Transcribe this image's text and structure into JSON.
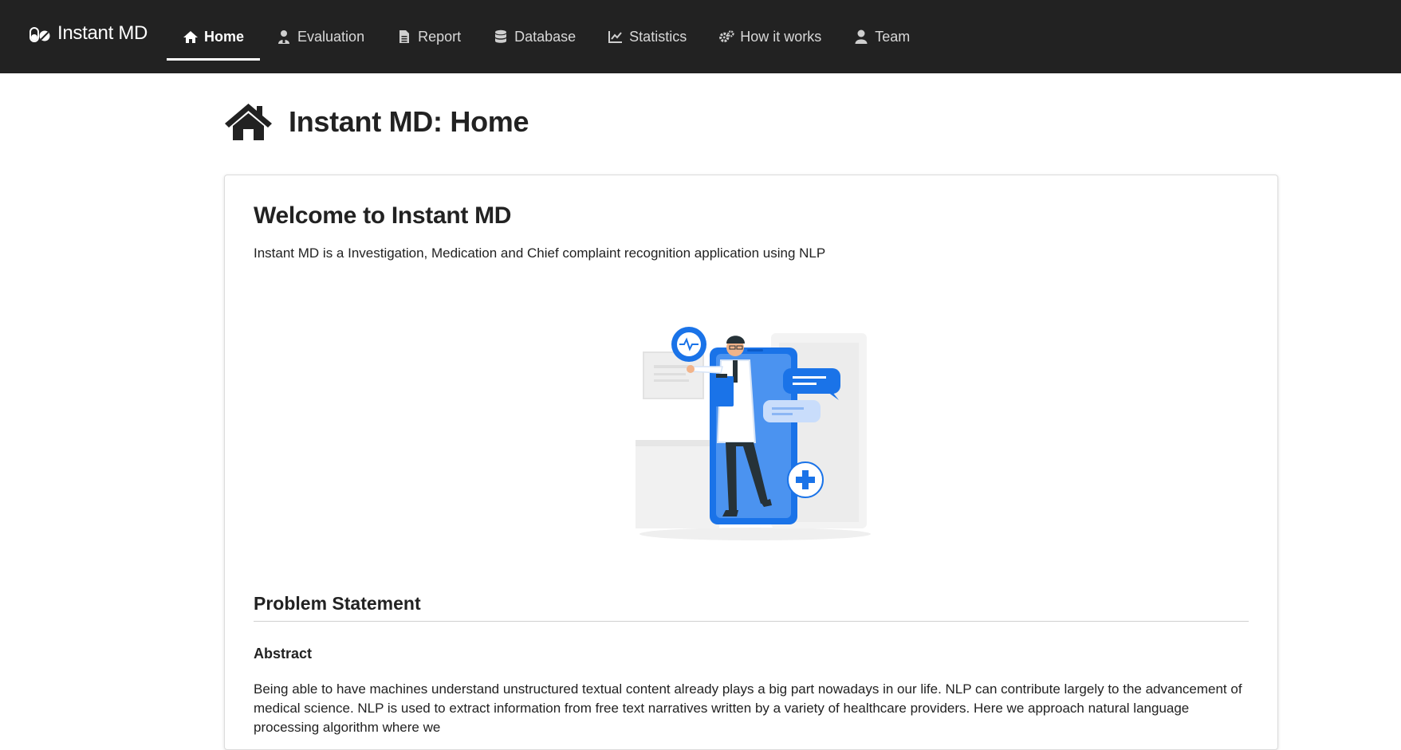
{
  "navbar": {
    "brand": "Instant MD",
    "brand_icon": "pills-icon",
    "background": "#222222",
    "items": [
      {
        "label": "Home",
        "icon": "home-icon",
        "active": true
      },
      {
        "label": "Evaluation",
        "icon": "user-doctor-icon",
        "active": false
      },
      {
        "label": "Report",
        "icon": "file-icon",
        "active": false
      },
      {
        "label": "Database",
        "icon": "database-icon",
        "active": false
      },
      {
        "label": "Statistics",
        "icon": "line-chart-icon",
        "active": false
      },
      {
        "label": "How it works",
        "icon": "gears-icon",
        "active": false
      },
      {
        "label": "Team",
        "icon": "user-icon",
        "active": false
      }
    ]
  },
  "page": {
    "title": "Instant MD: Home",
    "title_icon": "home-icon"
  },
  "card": {
    "heading": "Welcome to Instant MD",
    "lead": "Instant MD is a Investigation, Medication and Chief complaint recognition application using NLP",
    "illustration": "doctor-with-smartphone-illustration",
    "accent": "#1a73e8",
    "section_title": "Problem Statement",
    "abstract_title": "Abstract",
    "abstract_text": "Being able to have machines understand unstructured textual content already plays a big part nowadays in our life. NLP can contribute largely to the advancement of medical science. NLP is used to extract information from free text narratives written by a variety of healthcare providers. Here we approach natural language processing algorithm where we"
  }
}
